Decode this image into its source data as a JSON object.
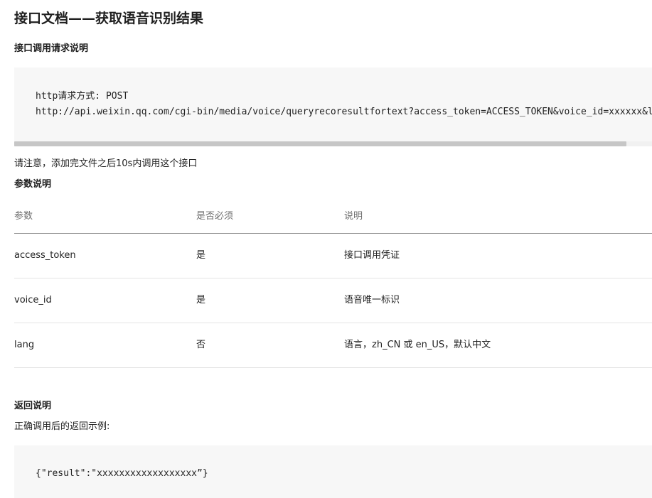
{
  "page_title": "接口文档——获取语音识别结果",
  "request_section": {
    "title": "接口调用请求说明",
    "code_lines": [
      "http请求方式: POST",
      "http://api.weixin.qq.com/cgi-bin/media/voice/queryrecoresultfortext?access_token=ACCESS_TOKEN&voice_id=xxxxxx&lang=zh_CN"
    ],
    "note": "请注意，添加完文件之后10s内调用这个接口"
  },
  "params_section": {
    "title": "参数说明",
    "headers": [
      "参数",
      "是否必须",
      "说明"
    ],
    "rows": [
      {
        "param": "access_token",
        "required": "是",
        "description": "接口调用凭证"
      },
      {
        "param": "voice_id",
        "required": "是",
        "description": "语音唯一标识"
      },
      {
        "param": "lang",
        "required": "否",
        "description": "语言，zh_CN 或 en_US，默认中文"
      }
    ]
  },
  "return_section": {
    "title": "返回说明",
    "subtitle": "正确调用后的返回示例:",
    "code_lines": [
      "{\"result\":\"xxxxxxxxxxxxxxxxxx”}"
    ]
  },
  "colors": {
    "code_background": "#f7f7f7",
    "scrollbar_thumb": "#c6c6c6",
    "header_text": "#6d6d6d",
    "header_rule": "#8e8e8e",
    "row_rule": "#e4e4e4"
  },
  "scrollbar": {
    "visible_fraction": 0.96
  }
}
